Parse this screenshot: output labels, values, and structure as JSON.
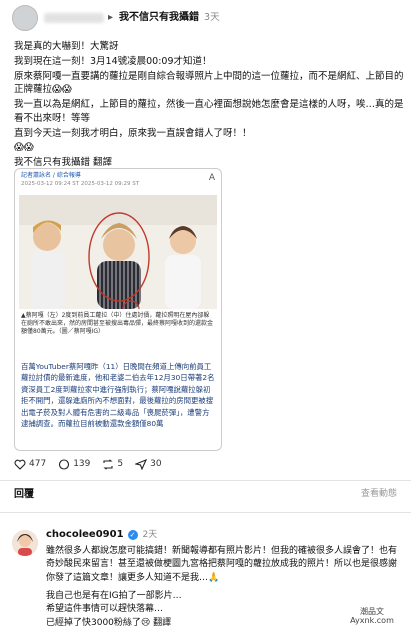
{
  "header": {
    "target_name": "我不信只有我攝錯",
    "time": "3天"
  },
  "post": {
    "lines": [
      "我是真的大嚇到！大驚訝",
      "我到現在這一刻！3月14號凌晨00:09才知道！",
      "原來蔡阿嘎一直要講的蘿拉是剛自綜合報導照片上中間的這一位蘿拉，而不是網紅、上節目的正牌蘿拉😱😱",
      "我一直以為是網紅，上節目的蘿拉，然後一直心裡面想說她怎麼會是這樣的人呀，唉…真的是看不出來呀！等等",
      "直到今天這一刻我才明白，原來我一直誤會錯人了呀！！",
      "😱😱",
      "我不信只有我攝錯 翻譯"
    ],
    "translate_label": "翻譯"
  },
  "card": {
    "source": "記者蕭詠名 / 綜合報導",
    "dates": "2025-03-12 09:24 ST  2025-03-12 09:29 ST",
    "aa": "A",
    "caption": "▲蔡阿嘎（左）2度到前員工蘿拉（中）住處討債，蘿拉照明在屋內卻躲在廁所不敢出來，然的房間甚至被搜出毒品彈，最終蔡阿嘎收到的還款金額僅80萬元。（圖／蔡阿嘎IG）",
    "article": "百萬YouTuber蔡阿嘎昨（11）日晚間在頻道上傳向前員工蘿拉討債的最新進度，他和老婆二伯去年12月30日帶著2名資深員工2度到蘿拉家中進行強制執行；蔡阿嘎說蘿拉躲初拒不開門，還躲進廁所內不想面對，最後蘿拉的房間更被搜出電子菸及對人體有危害的二級毒品「喪屍菸彈」，遭警方逮捕調查。而蘿拉目前被動還款金額僅80萬"
  },
  "actions": {
    "likes": "477",
    "comments": "139",
    "reposts": "5",
    "shares": "30"
  },
  "replies": {
    "label": "回覆",
    "view_activity": "查看動態"
  },
  "comment": {
    "username": "chocolee0901",
    "time": "2天",
    "p1": "雖然很多人都說怎麼可能搞錯！新聞報導都有照片影片！但我的確被很多人誤會了！也有奇妙酸民來留言！甚至還被做梗圖九宮格把蔡阿嘎的蘿拉放成我的照片！所以也是很感謝你發了這篇文章！讓更多人知道不是我…🙏",
    "p2": "我自己也是有在IG拍了一部影片…",
    "p3": "希望這件事情可以趕快落幕…",
    "p4": "已經掉了快3000粉絲了😢 翻譯"
  },
  "watermark": {
    "line1": "潮品文",
    "line2": "Ayxnk.com"
  }
}
